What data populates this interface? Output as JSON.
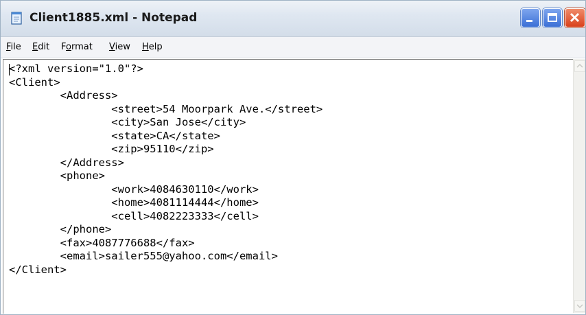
{
  "window": {
    "title": "Client1885.xml - Notepad"
  },
  "menu": [
    {
      "label": "File",
      "mnemonic": "F",
      "rest": "ile"
    },
    {
      "label": "Edit",
      "mnemonic": "E",
      "rest": "dit"
    },
    {
      "label": "Format",
      "mnemonic": "F",
      "pre": "",
      "rest_pre": "F",
      "u": "o",
      "rest": "rmat"
    },
    {
      "label": "View",
      "mnemonic": "V",
      "rest": "iew"
    },
    {
      "label": "Help",
      "mnemonic": "H",
      "rest": "elp"
    }
  ],
  "editor": {
    "lines": [
      "<?xml version=\"1.0\"?>",
      "<Client>",
      "        <Address>",
      "                <street>54 Moorpark Ave.</street>",
      "                <city>San Jose</city>",
      "                <state>CA</state>",
      "                <zip>95110</zip>",
      "        </Address>",
      "        <phone>",
      "                <work>4084630110</work>",
      "                <home>4081114444</home>",
      "                <cell>4082223333</cell>",
      "        </phone>",
      "        <fax>4087776688</fax>",
      "        <email>sailer555@yahoo.com</email>",
      "</Client>"
    ]
  },
  "icons": {
    "app": "notepad-icon",
    "minimize": "minimize-icon",
    "maximize": "maximize-icon",
    "close": "close-icon"
  }
}
